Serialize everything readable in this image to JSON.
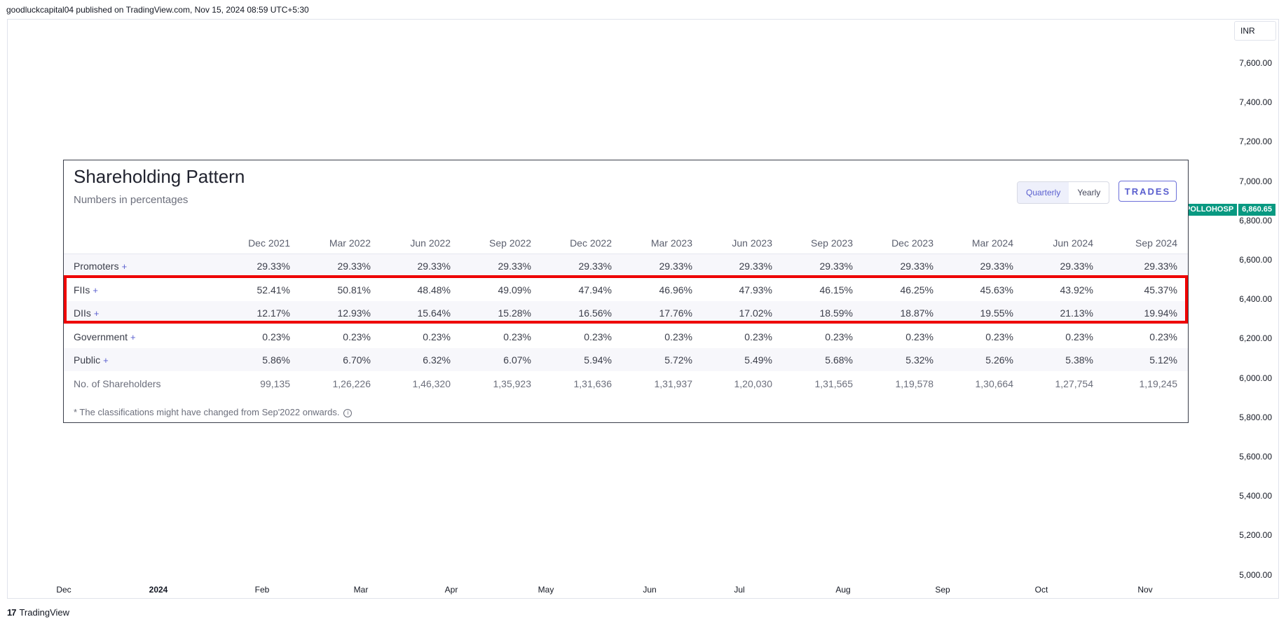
{
  "header": {
    "published": "goodluckcapital04 published on TradingView.com, Nov 15, 2024 08:59 UTC+5:30"
  },
  "chart": {
    "currency": "INR",
    "y_labels": [
      "7,600.00",
      "7,400.00",
      "7,200.00",
      "7,000.00",
      "6,800.00",
      "6,600.00",
      "6,400.00",
      "6,200.00",
      "6,000.00",
      "5,800.00",
      "5,600.00",
      "5,400.00",
      "5,200.00",
      "5,000.00"
    ],
    "x_labels": [
      "Dec",
      "2024",
      "Feb",
      "Mar",
      "Apr",
      "May",
      "Jun",
      "Jul",
      "Aug",
      "Sep",
      "Oct",
      "Nov"
    ],
    "symbol": "APOLLOHOSP",
    "last_price": "6,860.65",
    "up_color": "#089981"
  },
  "footer": {
    "brand": "TradingView",
    "logo": "tradingview-logo-icon"
  },
  "panel": {
    "title": "Shareholding Pattern",
    "subtitle": "Numbers in percentages",
    "toggle": [
      "Quarterly",
      "Yearly"
    ],
    "toggle_selected": "Quarterly",
    "trades_label": "TRADES",
    "columns": [
      "Dec 2021",
      "Mar 2022",
      "Jun 2022",
      "Sep 2022",
      "Dec 2022",
      "Mar 2023",
      "Jun 2023",
      "Sep 2023",
      "Dec 2023",
      "Mar 2024",
      "Jun 2024",
      "Sep 2024"
    ],
    "rows": [
      {
        "label": "Promoters",
        "plus": "+",
        "values": [
          "29.33%",
          "29.33%",
          "29.33%",
          "29.33%",
          "29.33%",
          "29.33%",
          "29.33%",
          "29.33%",
          "29.33%",
          "29.33%",
          "29.33%",
          "29.33%"
        ]
      },
      {
        "label": "FIIs",
        "plus": "+",
        "values": [
          "52.41%",
          "50.81%",
          "48.48%",
          "49.09%",
          "47.94%",
          "46.96%",
          "47.93%",
          "46.15%",
          "46.25%",
          "45.63%",
          "43.92%",
          "45.37%"
        ]
      },
      {
        "label": "DIIs",
        "plus": "+",
        "values": [
          "12.17%",
          "12.93%",
          "15.64%",
          "15.28%",
          "16.56%",
          "17.76%",
          "17.02%",
          "18.59%",
          "18.87%",
          "19.55%",
          "21.13%",
          "19.94%"
        ]
      },
      {
        "label": "Government",
        "plus": "+",
        "values": [
          "0.23%",
          "0.23%",
          "0.23%",
          "0.23%",
          "0.23%",
          "0.23%",
          "0.23%",
          "0.23%",
          "0.23%",
          "0.23%",
          "0.23%",
          "0.23%"
        ]
      },
      {
        "label": "Public",
        "plus": "+",
        "values": [
          "5.86%",
          "6.70%",
          "6.32%",
          "6.07%",
          "5.94%",
          "5.72%",
          "5.49%",
          "5.68%",
          "5.32%",
          "5.26%",
          "5.38%",
          "5.12%"
        ]
      },
      {
        "label": "No. of Shareholders",
        "plus": "",
        "values": [
          "99,135",
          "1,26,226",
          "1,46,320",
          "1,35,923",
          "1,31,636",
          "1,31,937",
          "1,20,030",
          "1,31,565",
          "1,19,578",
          "1,30,664",
          "1,27,754",
          "1,19,245"
        ]
      }
    ],
    "note": "* The classifications might have changed from Sep'2022 onwards.",
    "highlight_color": "#ee0000"
  }
}
